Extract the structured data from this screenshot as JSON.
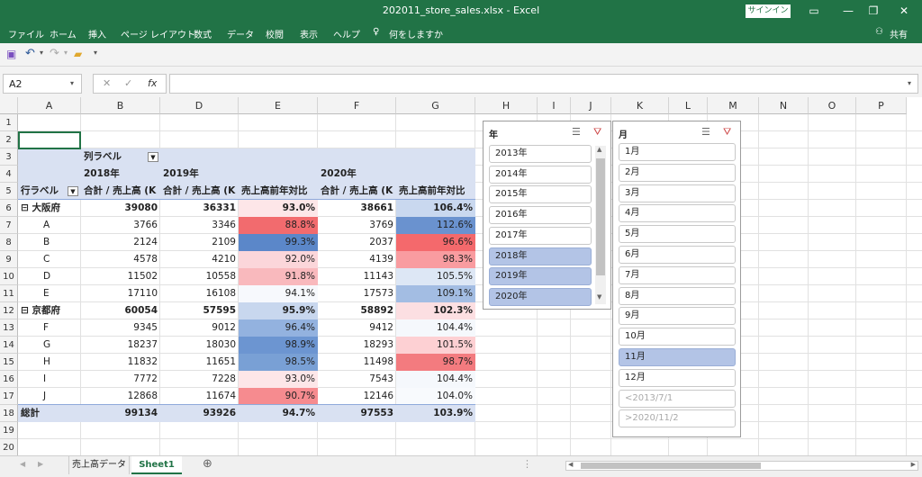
{
  "window": {
    "title": "202011_store_sales.xlsx  -  Excel",
    "signin": "サインイン"
  },
  "menu": [
    "ファイル",
    "ホーム",
    "挿入",
    "ページ レイアウト",
    "数式",
    "データ",
    "校閲",
    "表示",
    "ヘルプ",
    "何をしますか",
    "共有"
  ],
  "name_box": "A2",
  "columns": [
    "A",
    "B",
    "D",
    "E",
    "F",
    "G",
    "H",
    "I",
    "J",
    "K",
    "L",
    "M",
    "N",
    "O",
    "P"
  ],
  "rows": [
    "1",
    "2",
    "3",
    "4",
    "5",
    "6",
    "7",
    "8",
    "9",
    "10",
    "11",
    "12",
    "13",
    "14",
    "15",
    "16",
    "17",
    "18",
    "19",
    "20"
  ],
  "pivot": {
    "col_label": "列ラベル",
    "row_label": "行ラベル",
    "years": [
      "2018年",
      "2019年",
      "2020年"
    ],
    "sum_header": "合計 / 売上高 (K",
    "ratio_header": "売上高前年対比",
    "data": [
      {
        "label": "⊟ 大阪府",
        "bold": true,
        "v": [
          "39080",
          "36331",
          "93.0%",
          "38661",
          "106.4%"
        ]
      },
      {
        "label": "A",
        "v": [
          "3766",
          "3346",
          "88.8%",
          "3769",
          "112.6%"
        ]
      },
      {
        "label": "B",
        "v": [
          "2124",
          "2109",
          "99.3%",
          "2037",
          "96.6%"
        ]
      },
      {
        "label": "C",
        "v": [
          "4578",
          "4210",
          "92.0%",
          "4139",
          "98.3%"
        ]
      },
      {
        "label": "D",
        "v": [
          "11502",
          "10558",
          "91.8%",
          "11143",
          "105.5%"
        ]
      },
      {
        "label": "E",
        "v": [
          "17110",
          "16108",
          "94.1%",
          "17573",
          "109.1%"
        ]
      },
      {
        "label": "⊟ 京都府",
        "bold": true,
        "v": [
          "60054",
          "57595",
          "95.9%",
          "58892",
          "102.3%"
        ]
      },
      {
        "label": "F",
        "v": [
          "9345",
          "9012",
          "96.4%",
          "9412",
          "104.4%"
        ]
      },
      {
        "label": "G",
        "v": [
          "18237",
          "18030",
          "98.9%",
          "18293",
          "101.5%"
        ]
      },
      {
        "label": "H",
        "v": [
          "11832",
          "11651",
          "98.5%",
          "11498",
          "98.7%"
        ]
      },
      {
        "label": "I",
        "v": [
          "7772",
          "7228",
          "93.0%",
          "7543",
          "104.4%"
        ]
      },
      {
        "label": "J",
        "v": [
          "12868",
          "11674",
          "90.7%",
          "12146",
          "104.0%"
        ]
      },
      {
        "label": "総計",
        "bold": true,
        "v": [
          "99134",
          "93926",
          "94.7%",
          "97553",
          "103.9%"
        ]
      }
    ],
    "e_colors": [
      "#fde6e8",
      "#f26b6e",
      "#5b87c9",
      "#fbd6da",
      "#f9b9bd",
      "#f7f9fd",
      "#c8d7ee",
      "#93b2df",
      "#6c95d1",
      "#79a0d5",
      "#fde6e8",
      "#f68b8f",
      "#e2e9f5"
    ],
    "g_colors": [
      "#c9d8ef",
      "#6a92cf",
      "#f4696c",
      "#f99ca0",
      "#dde7f5",
      "#a3bde3",
      "#fcdfe2",
      "#f5f8fc",
      "#fdd0d3",
      "#f37b7f",
      "#f5f8fc",
      "#f8fafd",
      "#ffffff"
    ]
  },
  "slicer_year": {
    "title": "年",
    "items": [
      "2013年",
      "2014年",
      "2015年",
      "2016年",
      "2017年",
      "2018年",
      "2019年",
      "2020年"
    ],
    "selected": [
      false,
      false,
      false,
      false,
      false,
      true,
      true,
      true
    ]
  },
  "slicer_month": {
    "title": "月",
    "items": [
      "1月",
      "2月",
      "3月",
      "4月",
      "5月",
      "6月",
      "7月",
      "8月",
      "9月",
      "10月",
      "11月",
      "12月",
      "<2013/7/1",
      ">2020/11/2"
    ],
    "selected": [
      false,
      false,
      false,
      false,
      false,
      false,
      false,
      false,
      false,
      false,
      true,
      false,
      false,
      false
    ],
    "gray": [
      false,
      false,
      false,
      false,
      false,
      false,
      false,
      false,
      false,
      false,
      false,
      false,
      true,
      true
    ]
  },
  "sheets": [
    "売上高データ",
    "Sheet1"
  ],
  "colors": {
    "excel_green": "#217346",
    "header_fill": "#d9e1f2"
  }
}
